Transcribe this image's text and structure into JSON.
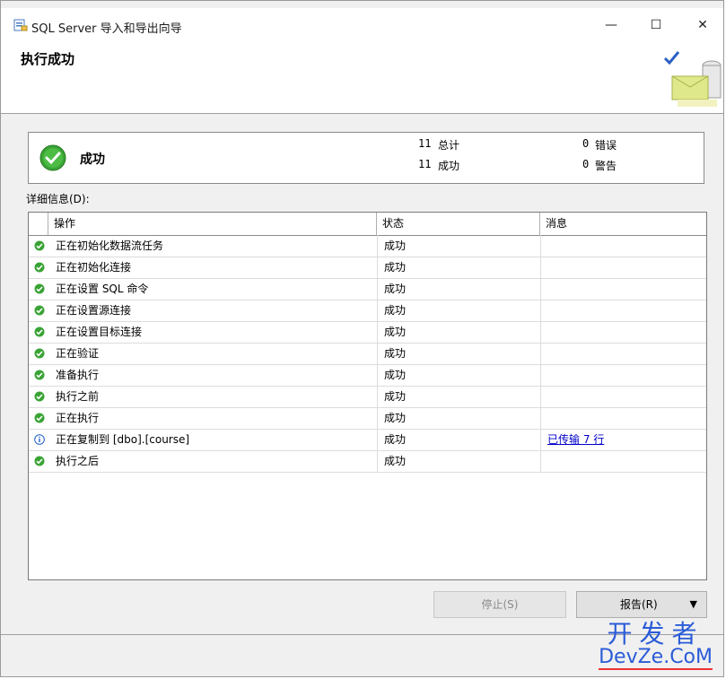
{
  "window": {
    "title": "SQL Server 导入和导出向导",
    "minimize": "—",
    "maximize": "☐",
    "close": "✕"
  },
  "header": {
    "page_title": "执行成功"
  },
  "summary": {
    "status_label": "成功",
    "total_count": "11",
    "total_label": "总计",
    "success_count": "11",
    "success_label": "成功",
    "error_count": "0",
    "error_label": "错误",
    "warning_count": "0",
    "warning_label": "警告"
  },
  "details": {
    "label": "详细信息(D):",
    "columns": [
      "操作",
      "状态",
      "消息"
    ],
    "rows": [
      {
        "icon": "success-check-icon",
        "operation": "正在初始化数据流任务",
        "status": "成功",
        "message": ""
      },
      {
        "icon": "success-check-icon",
        "operation": "正在初始化连接",
        "status": "成功",
        "message": ""
      },
      {
        "icon": "success-check-icon",
        "operation": "正在设置 SQL 命令",
        "status": "成功",
        "message": ""
      },
      {
        "icon": "success-check-icon",
        "operation": "正在设置源连接",
        "status": "成功",
        "message": ""
      },
      {
        "icon": "success-check-icon",
        "operation": "正在设置目标连接",
        "status": "成功",
        "message": ""
      },
      {
        "icon": "success-check-icon",
        "operation": "正在验证",
        "status": "成功",
        "message": ""
      },
      {
        "icon": "success-check-icon",
        "operation": "准备执行",
        "status": "成功",
        "message": ""
      },
      {
        "icon": "success-check-icon",
        "operation": "执行之前",
        "status": "成功",
        "message": ""
      },
      {
        "icon": "success-check-icon",
        "operation": "正在执行",
        "status": "成功",
        "message": ""
      },
      {
        "icon": "info-icon",
        "operation": "正在复制到 [dbo].[course]",
        "status": "成功",
        "message": "已传输 7 行"
      },
      {
        "icon": "success-check-icon",
        "operation": "执行之后",
        "status": "成功",
        "message": ""
      }
    ]
  },
  "buttons": {
    "stop": "停止(S)",
    "report": "报告(R)",
    "report_arrow": "▼"
  },
  "watermark": {
    "top": "开发者",
    "bottom": "DevZe.CoM"
  },
  "colors": {
    "success_green": "#3aa335",
    "link_blue": "#0000cc",
    "info_blue": "#1e5fc7"
  }
}
